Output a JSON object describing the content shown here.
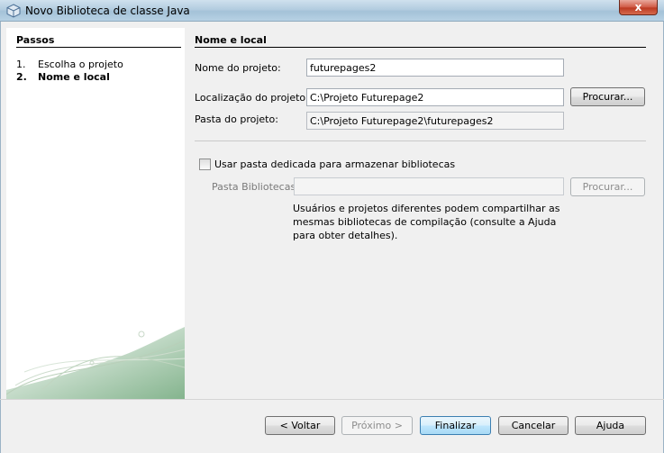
{
  "window": {
    "title": "Novo Biblioteca de classe Java",
    "close_glyph": "x",
    "icon": "java-library-cube-icon"
  },
  "steps": {
    "heading": "Passos",
    "items": [
      {
        "num": "1.",
        "label": "Escolha o projeto"
      },
      {
        "num": "2.",
        "label": "Nome e local"
      }
    ]
  },
  "main": {
    "title": "Nome e local",
    "project_name_label": "Nome do projeto:",
    "project_name_value": "futurepages2",
    "location_label": "Localização do projeto:",
    "location_value": "C:\\Projeto Futurepage2",
    "browse_label": "Procurar...",
    "folder_label": "Pasta do projeto:",
    "folder_value": "C:\\Projeto Futurepage2\\futurepages2",
    "dedicated_checkbox_label": "Usar pasta dedicada para armazenar bibliotecas",
    "dedicated_checked": false,
    "libraries_label": "Pasta Bibliotecas:",
    "libraries_value": "",
    "libraries_browse_label": "Procurar...",
    "help_text": "Usuários e projetos diferentes podem compartilhar as mesmas bibliotecas de compilação (consulte a Ajuda para obter detalhes)."
  },
  "footer": {
    "back": "< Voltar",
    "next": "Próximo >",
    "finish": "Finalizar",
    "cancel": "Cancelar",
    "help": "Ajuda"
  }
}
